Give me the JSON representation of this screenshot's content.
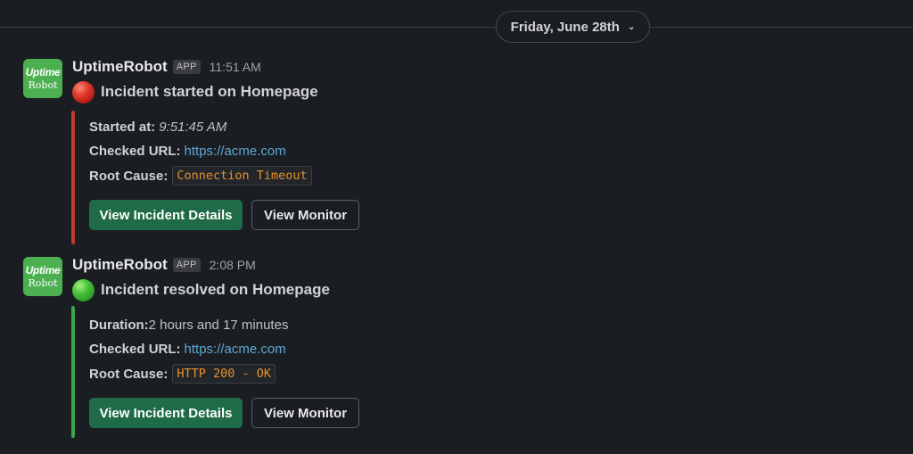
{
  "date_divider": {
    "label": "Friday, June 28th",
    "chevron": "chevron-down-icon"
  },
  "messages": [
    {
      "avatar": {
        "line1": "Uptime",
        "line2": "Robot",
        "color": "#4caf50"
      },
      "sender": "UptimeRobot",
      "badge": "APP",
      "time": "11:51 AM",
      "status_icon": "red-circle-icon",
      "title": "Incident started on Homepage",
      "accent_color": "#c0392b",
      "field1": {
        "key": "Started at:",
        "value": "9:51:45 AM"
      },
      "field2": {
        "key": "Checked URL:",
        "value": "https://acme.com"
      },
      "field3": {
        "key": "Root Cause:",
        "value": "Connection Timeout"
      },
      "buttons": {
        "primary": "View Incident Details",
        "secondary": "View Monitor"
      }
    },
    {
      "avatar": {
        "line1": "Uptime",
        "line2": "Robot",
        "color": "#4caf50"
      },
      "sender": "UptimeRobot",
      "badge": "APP",
      "time": "2:08 PM",
      "status_icon": "green-circle-icon",
      "title": "Incident resolved on Homepage",
      "accent_color": "#3fa34d",
      "field1": {
        "key": "Duration:",
        "value": " 2 hours and 17 minutes"
      },
      "field2": {
        "key": "Checked URL:",
        "value": "https://acme.com"
      },
      "field3": {
        "key": "Root Cause:",
        "value": "HTTP 200 - OK"
      },
      "buttons": {
        "primary": "View Incident Details",
        "secondary": "View Monitor"
      }
    }
  ],
  "colors": {
    "background": "#1a1d21",
    "link": "#5fa8d3",
    "code": "#e8912d",
    "primary_button": "#1f6b47"
  }
}
